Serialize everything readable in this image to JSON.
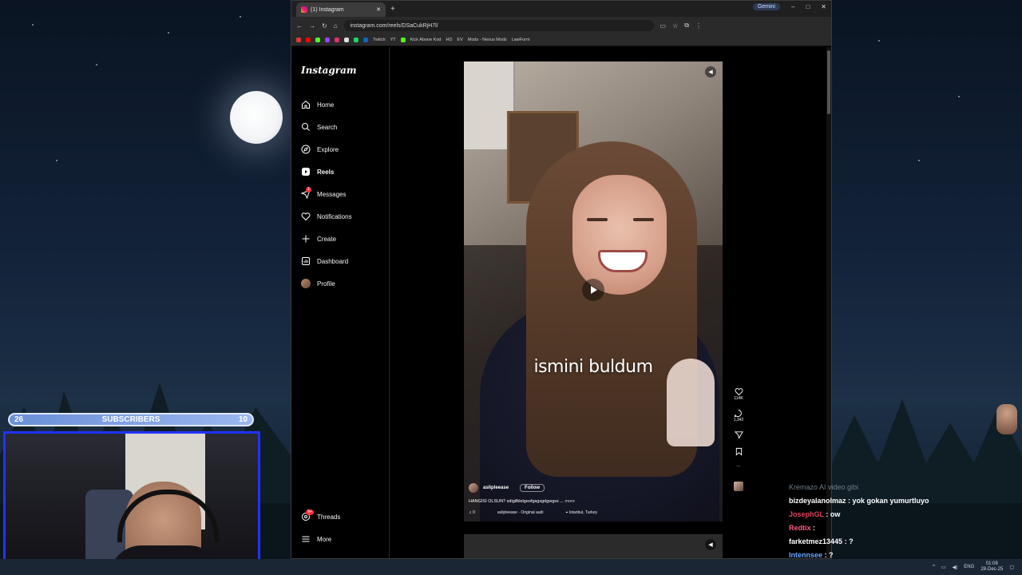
{
  "browser": {
    "tab_title": "(1) Instagram",
    "url": "instagram.com/reels/DSaCukRjH7l/",
    "gemini_label": "Gemini",
    "bookmarks": [
      "Twitch",
      "YT",
      "Kick Abone Kod",
      "HD",
      "EV",
      "Mods - Nexus Mods",
      "LawForm"
    ]
  },
  "instagram": {
    "logo": "Instagram",
    "nav": [
      {
        "label": "Home",
        "icon": "home-icon"
      },
      {
        "label": "Search",
        "icon": "search-icon"
      },
      {
        "label": "Explore",
        "icon": "explore-icon"
      },
      {
        "label": "Reels",
        "icon": "reels-icon",
        "active": true
      },
      {
        "label": "Messages",
        "icon": "messages-icon",
        "badge": "1"
      },
      {
        "label": "Notifications",
        "icon": "heart-icon"
      },
      {
        "label": "Create",
        "icon": "plus-icon"
      },
      {
        "label": "Dashboard",
        "icon": "dashboard-icon"
      },
      {
        "label": "Profile",
        "icon": "avatar"
      }
    ],
    "bottom_nav": [
      {
        "label": "Threads",
        "icon": "threads-icon",
        "badge": "9+"
      },
      {
        "label": "More",
        "icon": "menu-icon"
      }
    ],
    "reel": {
      "caption_overlay": "ismini buldum",
      "username": "aslipleease",
      "follow_label": "Follow",
      "description": "HANGİSİ OLSUN? sdigifklelgeofgsgsgdgwgss ...",
      "more_label": "more",
      "audio_count": "0",
      "audio": "aslipleease · Original audi",
      "location": "Istanbul, Turkey",
      "likes": "114K",
      "comments": "1,342"
    }
  },
  "overlay": {
    "sub_left": "26",
    "sub_title": "SUBSCRIBERS",
    "sub_right": "10",
    "chat": [
      {
        "user": "Kremazo",
        "text": "AI video gibi",
        "faded": true
      },
      {
        "user": "bizdeyalanolmaz",
        "text": "yok gokan yumurtluyo"
      },
      {
        "user": "JosephGL",
        "text": "ow"
      },
      {
        "user": "Redtix",
        "text": ""
      },
      {
        "user": "farketmez13445",
        "text": "?"
      },
      {
        "user": "Intennsee",
        "text": "?"
      }
    ]
  },
  "taskbar": {
    "lang": "ENG",
    "time": "01:08",
    "date": "28-Dec-25"
  }
}
